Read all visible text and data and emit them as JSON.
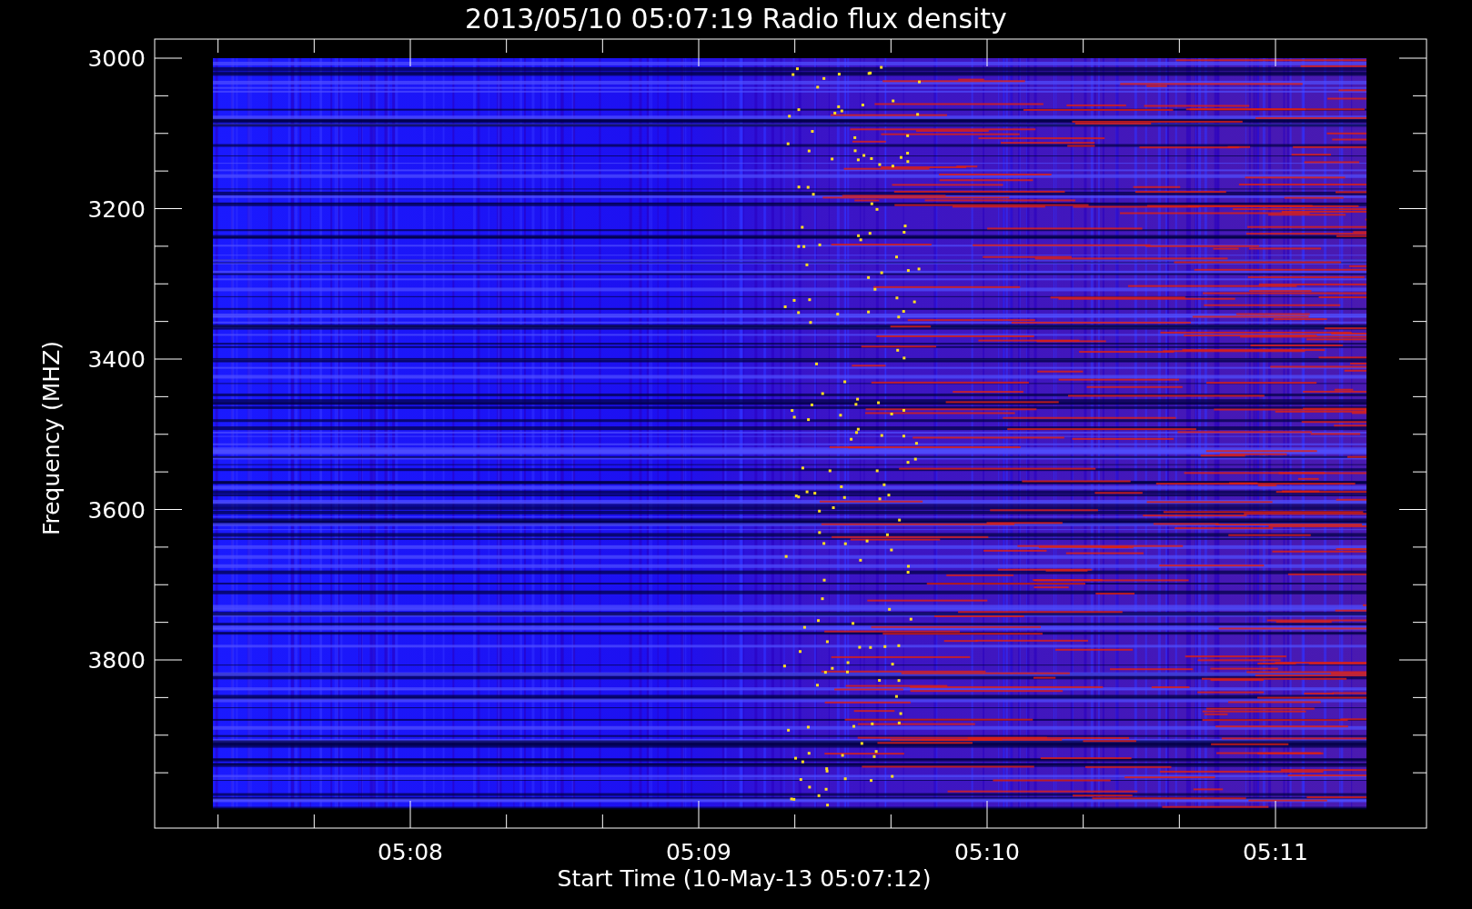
{
  "title": "2013/05/10 05:07:19 Radio flux density",
  "y_axis": {
    "label": "Frequency (MHZ)",
    "ticks": [
      "3000",
      "3200",
      "3400",
      "3600",
      "3800"
    ]
  },
  "x_axis": {
    "label": "Start Time (10-May-13 05:07:12)",
    "ticks": [
      "05:08",
      "05:09",
      "05:10",
      "05:11"
    ]
  }
}
